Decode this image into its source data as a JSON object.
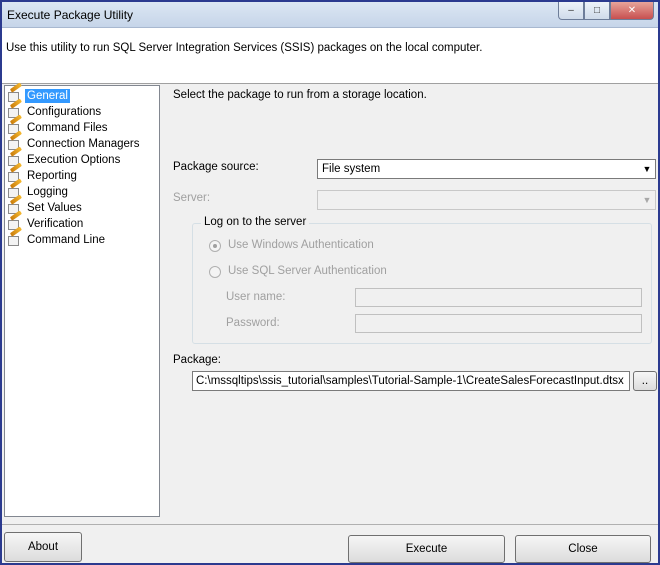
{
  "window": {
    "title": "Execute Package Utility",
    "controls": {
      "minimize": "–",
      "maximize": "□",
      "close": "✕"
    }
  },
  "banner": {
    "text": "Use this utility to run SQL Server Integration Services (SSIS) packages on the local computer."
  },
  "nav": {
    "items": [
      {
        "label": "General",
        "selected": true
      },
      {
        "label": "Configurations"
      },
      {
        "label": "Command Files"
      },
      {
        "label": "Connection Managers"
      },
      {
        "label": "Execution Options"
      },
      {
        "label": "Reporting"
      },
      {
        "label": "Logging"
      },
      {
        "label": "Set Values"
      },
      {
        "label": "Verification"
      },
      {
        "label": "Command Line"
      }
    ]
  },
  "general": {
    "instruction": "Select the package to run from a storage location.",
    "package_source_label": "Package source:",
    "package_source_value": "File system",
    "server_label": "Server:",
    "server_value": "",
    "logon_group_label": "Log on to the server",
    "windows_auth_label": "Use Windows Authentication",
    "sql_auth_label": "Use SQL Server Authentication",
    "username_label": "User name:",
    "password_label": "Password:",
    "package_label": "Package:",
    "package_path": "C:\\mssqltips\\ssis_tutorial\\samples\\Tutorial-Sample-1\\CreateSalesForecastInput.dtsx",
    "browse_label": ".."
  },
  "footer": {
    "about_label": "About",
    "execute_label": "Execute",
    "close_label": "Close"
  },
  "icons": {
    "dropdown": "▼",
    "nav_item": "pen-document-icon"
  },
  "colors": {
    "selection": "#3399ff",
    "frame": "#2b3a8f"
  }
}
